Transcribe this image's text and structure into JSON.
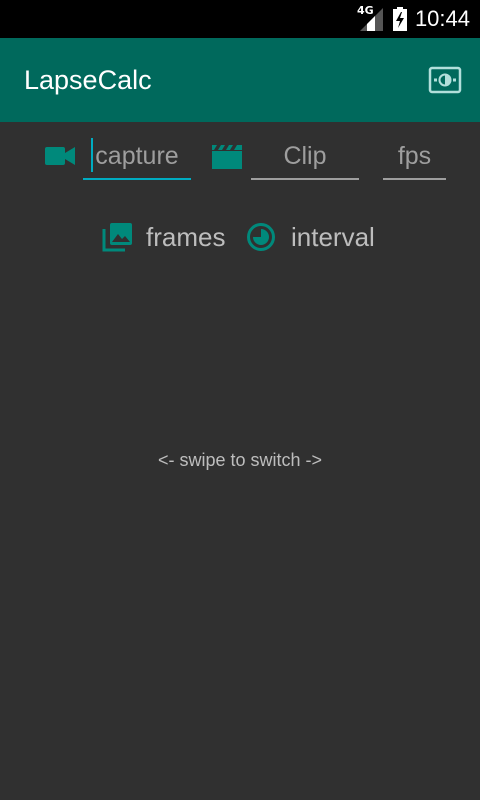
{
  "status_bar": {
    "network": "4G",
    "time": "10:44",
    "icons": [
      "signal-icon",
      "battery-charging-icon"
    ]
  },
  "app_bar": {
    "title": "LapseCalc",
    "action_icon": "settings-brightness-icon"
  },
  "inputs": {
    "capture": {
      "placeholder": "capture",
      "icon": "videocam-icon"
    },
    "clip": {
      "placeholder": "Clip",
      "icon": "movie-clapper-icon"
    },
    "fps": {
      "placeholder": "fps"
    }
  },
  "modes": {
    "frames": {
      "label": "frames",
      "icon": "photo-library-icon"
    },
    "interval": {
      "label": "interval",
      "icon": "timelapse-icon"
    }
  },
  "hint": "<- swipe to switch ->",
  "colors": {
    "status_bar": "#000000",
    "app_bar": "#00695c",
    "background": "#303030",
    "accent": "#00897b",
    "cursor": "#00acc1",
    "text": "#bdbdbd"
  }
}
